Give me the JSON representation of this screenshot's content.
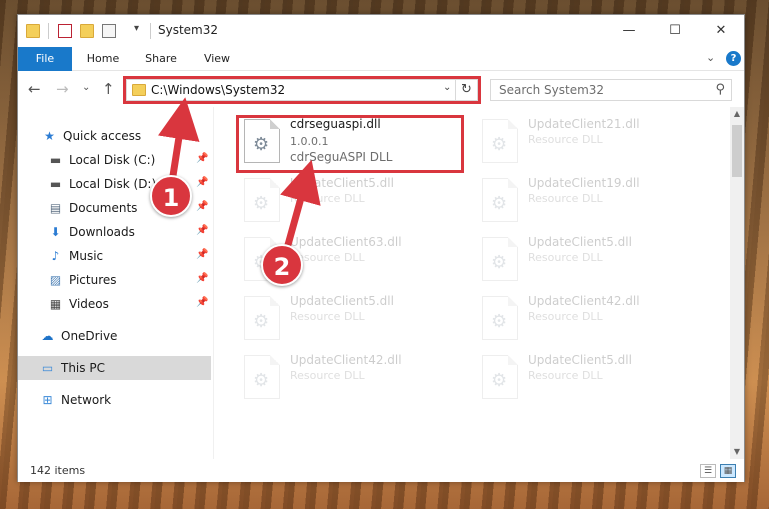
{
  "window": {
    "title": "System32",
    "minimize_glyph": "—",
    "maximize_glyph": "☐",
    "close_glyph": "✕"
  },
  "ribbon": {
    "tabs": [
      "File",
      "Home",
      "Share",
      "View"
    ],
    "expand_glyph": "⌄",
    "help_glyph": "?"
  },
  "nav": {
    "back_glyph": "←",
    "forward_glyph": "→",
    "recent_glyph": "⌄",
    "up_glyph": "↑",
    "address": "C:\\Windows\\System32",
    "address_drop_glyph": "⌄",
    "refresh_glyph": "↻",
    "search_placeholder": "Search System32",
    "search_glyph": "⚲"
  },
  "sidebar": {
    "items": [
      {
        "label": "Quick access",
        "icon": "star-icon",
        "glyph": "★",
        "color": "#2b7cd3"
      },
      {
        "label": "Local Disk (C:)",
        "icon": "drive-icon",
        "glyph": "▬",
        "color": "#555555",
        "pin": "📌"
      },
      {
        "label": "Local Disk (D:)",
        "icon": "drive-icon",
        "glyph": "▬",
        "color": "#555555",
        "pin": "📌"
      },
      {
        "label": "Documents",
        "icon": "document-icon",
        "glyph": "▤",
        "color": "#5b6e82",
        "pin": "📌"
      },
      {
        "label": "Downloads",
        "icon": "download-icon",
        "glyph": "⬇",
        "color": "#2b7cd3",
        "pin": "📌"
      },
      {
        "label": "Music",
        "icon": "music-icon",
        "glyph": "♪",
        "color": "#2b7cd3",
        "pin": "📌"
      },
      {
        "label": "Pictures",
        "icon": "pictures-icon",
        "glyph": "▨",
        "color": "#4a7fb5",
        "pin": "📌"
      },
      {
        "label": "Videos",
        "icon": "video-icon",
        "glyph": "▦",
        "color": "#444444",
        "pin": "📌"
      },
      {
        "label": "OneDrive",
        "icon": "cloud-icon",
        "glyph": "☁",
        "color": "#1e73c8"
      },
      {
        "label": "This PC",
        "icon": "computer-icon",
        "glyph": "▭",
        "color": "#3b8ad8",
        "selected": true
      },
      {
        "label": "Network",
        "icon": "network-icon",
        "glyph": "⊞",
        "color": "#3b8ad8"
      }
    ]
  },
  "files": [
    {
      "name": "cdrseguaspi.dll",
      "version": "1.0.0.1",
      "description": "cdrSeguASPI DLL",
      "highlighted": true
    },
    {
      "name": "UpdateClient21.dll",
      "description": "Resource DLL"
    },
    {
      "name": "UpdateClient5.dll",
      "description": "Resource DLL"
    },
    {
      "name": "UpdateClient19.dll",
      "description": "Resource DLL"
    },
    {
      "name": "UpdateClient63.dll",
      "description": "Resource DLL"
    },
    {
      "name": "UpdateClient5.dll",
      "description": "Resource DLL"
    },
    {
      "name": "UpdateClient5.dll",
      "description": "Resource DLL"
    },
    {
      "name": "UpdateClient42.dll",
      "description": "Resource DLL"
    },
    {
      "name": "UpdateClient42.dll",
      "description": "Resource DLL"
    },
    {
      "name": "UpdateClient5.dll",
      "description": "Resource DLL"
    }
  ],
  "status": {
    "count": "142 items"
  },
  "annotations": {
    "step1": "1",
    "step2": "2",
    "color": "#d9363e"
  }
}
